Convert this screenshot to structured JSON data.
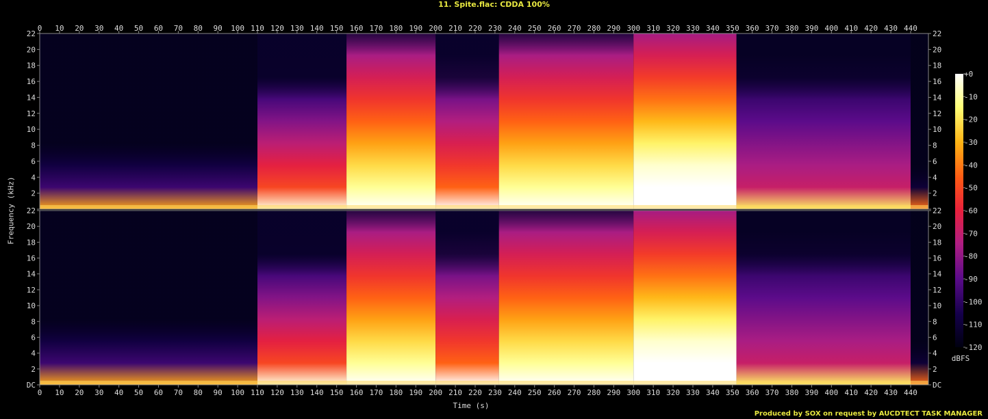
{
  "title": "11. Spite.flac: CDDA 100%",
  "credit": "Produced by SOX on request by AUCDTECT TASK MANAGER",
  "colors": {
    "background": "#000000",
    "title": "#e8e840",
    "axis": "#888888",
    "colormap": [
      "#000010",
      "#14004a",
      "#5a0b8a",
      "#b01e82",
      "#e8203c",
      "#ff5a14",
      "#ffb414",
      "#ffff78",
      "#ffffff"
    ]
  },
  "chart_data": {
    "type": "heatmap",
    "xlabel": "Time (s)",
    "ylabel": "Frequency (kHz)",
    "colorbar_label": "dBFS",
    "x_range": [
      0,
      449
    ],
    "y_range": [
      0,
      22
    ],
    "channels": 2,
    "x_ticks": [
      "0",
      "10",
      "20",
      "30",
      "40",
      "50",
      "60",
      "70",
      "80",
      "90",
      "100",
      "110",
      "120",
      "130",
      "140",
      "150",
      "160",
      "170",
      "180",
      "190",
      "200",
      "210",
      "220",
      "230",
      "240",
      "250",
      "260",
      "270",
      "280",
      "290",
      "300",
      "310",
      "320",
      "330",
      "340",
      "350",
      "360",
      "370",
      "380",
      "390",
      "400",
      "410",
      "420",
      "430",
      "440"
    ],
    "y_ticks": [
      "DC",
      "2",
      "4",
      "6",
      "8",
      "10",
      "12",
      "14",
      "16",
      "18",
      "20",
      "22"
    ],
    "colorbar_ticks": [
      "+0",
      "-10",
      "-20",
      "-30",
      "-40",
      "-50",
      "-60",
      "-70",
      "-80",
      "-90",
      "-100",
      "-110",
      "-120"
    ],
    "colorbar_range": [
      -120,
      0
    ],
    "sections": [
      {
        "start": 0,
        "end": 110,
        "intensity": 0.18,
        "bandwidth_khz": 6
      },
      {
        "start": 110,
        "end": 155,
        "intensity": 0.42,
        "bandwidth_khz": 14
      },
      {
        "start": 155,
        "end": 200,
        "intensity": 0.62,
        "bandwidth_khz": 21
      },
      {
        "start": 200,
        "end": 232,
        "intensity": 0.45,
        "bandwidth_khz": 16
      },
      {
        "start": 232,
        "end": 300,
        "intensity": 0.62,
        "bandwidth_khz": 21
      },
      {
        "start": 300,
        "end": 352,
        "intensity": 0.72,
        "bandwidth_khz": 22
      },
      {
        "start": 352,
        "end": 440,
        "intensity": 0.3,
        "bandwidth_khz": 16
      },
      {
        "start": 440,
        "end": 449,
        "intensity": 0.1,
        "bandwidth_khz": 4
      }
    ]
  }
}
